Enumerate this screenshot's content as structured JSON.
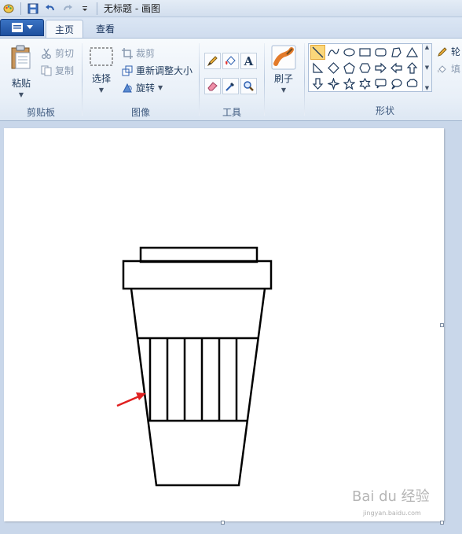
{
  "window": {
    "title": "无标题 - 画图"
  },
  "tabs": [
    {
      "label": "主页",
      "active": true
    },
    {
      "label": "查看",
      "active": false
    }
  ],
  "ribbon": {
    "clipboard": {
      "paste_label": "粘贴",
      "cut_label": "剪切",
      "copy_label": "复制",
      "group_label": "剪贴板"
    },
    "image": {
      "select_label": "选择",
      "crop_label": "裁剪",
      "resize_label": "重新调整大小",
      "rotate_label": "旋转",
      "group_label": "图像"
    },
    "tools": {
      "group_label": "工具",
      "items": [
        "pencil-icon",
        "fill-icon",
        "text-icon",
        "eraser-icon",
        "color-picker-icon",
        "magnifier-icon"
      ]
    },
    "brushes": {
      "label": "刷子"
    },
    "shapes": {
      "group_label": "形状",
      "selected": "line-shape",
      "outline_label": "轮",
      "fill_label": "填"
    }
  },
  "colors": {
    "accent": "#1d4f9e",
    "selection": "#fbd77b",
    "arrow": "#e02020"
  },
  "watermark": {
    "text": "Bai du 经验",
    "url": "jingyan.baidu.com"
  }
}
